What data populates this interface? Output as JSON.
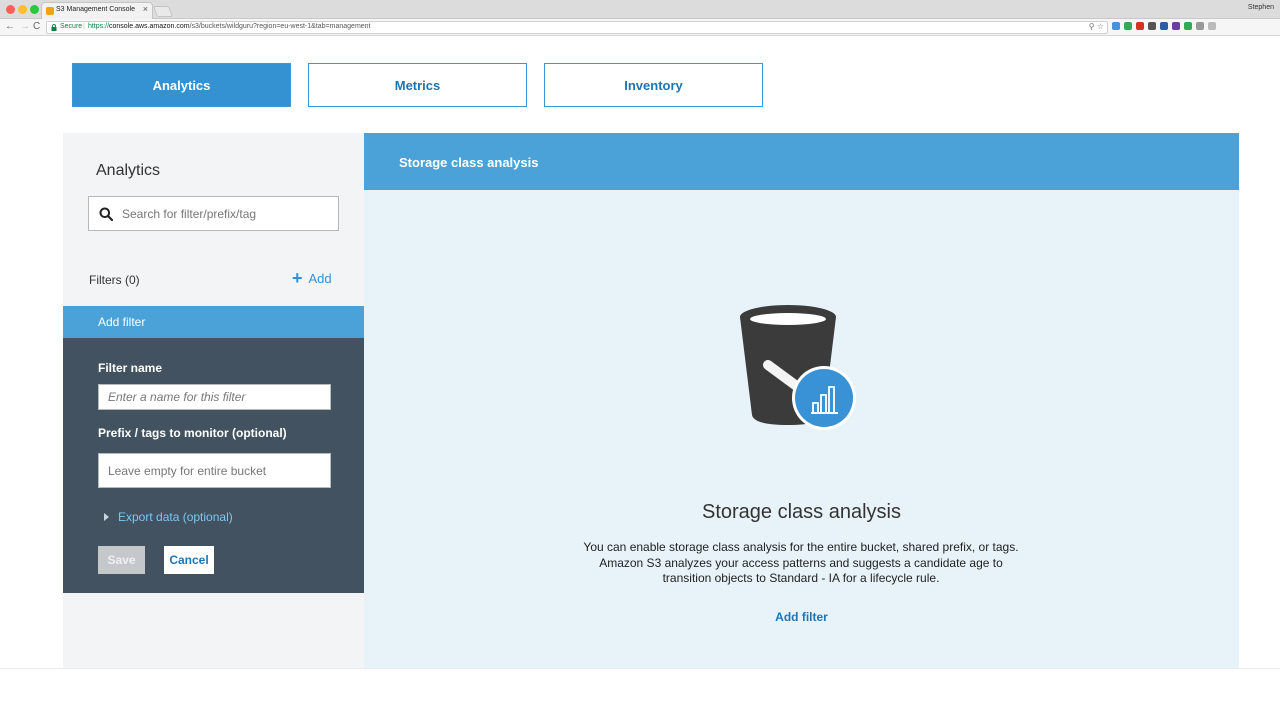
{
  "browser": {
    "tab_title": "S3 Management Console",
    "tab_close": "×",
    "user_name": "Stephen",
    "secure_label": "Secure",
    "url_scheme": "https://",
    "url_host": "console.aws.amazon.com",
    "url_path": "/s3/buckets/wildguru?region=eu-west-1&tab=management",
    "omni_icons": "⚲ ☆",
    "nav_back": "←",
    "nav_forward": "→",
    "nav_reload": "C",
    "extension_colors": [
      "#4a90d9",
      "#34a853",
      "#d93025",
      "#555555",
      "#2d5fa0",
      "#6a3da8",
      "#34a853",
      "#999999",
      "#bbbbbb"
    ]
  },
  "tabs": [
    {
      "label": "Analytics",
      "active": true
    },
    {
      "label": "Metrics",
      "active": false
    },
    {
      "label": "Inventory",
      "active": false
    }
  ],
  "sidebar": {
    "title": "Analytics",
    "search_placeholder": "Search for filter/prefix/tag",
    "filters_label": "Filters (0)",
    "add_label": "Add",
    "add_icon": "+"
  },
  "add_filter_form": {
    "header": "Add filter",
    "filter_name_label": "Filter name",
    "filter_name_placeholder": "Enter a name for this filter",
    "prefix_label": "Prefix / tags to monitor (optional)",
    "prefix_placeholder": "Leave empty for entire bucket",
    "export_label": "Export data (optional)",
    "save_label": "Save",
    "cancel_label": "Cancel"
  },
  "main": {
    "header_title": "Storage class analysis",
    "empty_title": "Storage class analysis",
    "empty_description": "You can enable storage class analysis for the entire bucket, shared prefix, or tags. Amazon S3 analyzes your access patterns and suggests a candidate age to transition objects to Standard - IA for a lifecycle rule.",
    "add_filter_link": "Add filter"
  },
  "colors": {
    "accent": "#3492d2",
    "header_blue": "#4aa2d9",
    "form_bg": "#425260",
    "right_bg": "#e8f3f9",
    "link": "#1f74b3"
  }
}
